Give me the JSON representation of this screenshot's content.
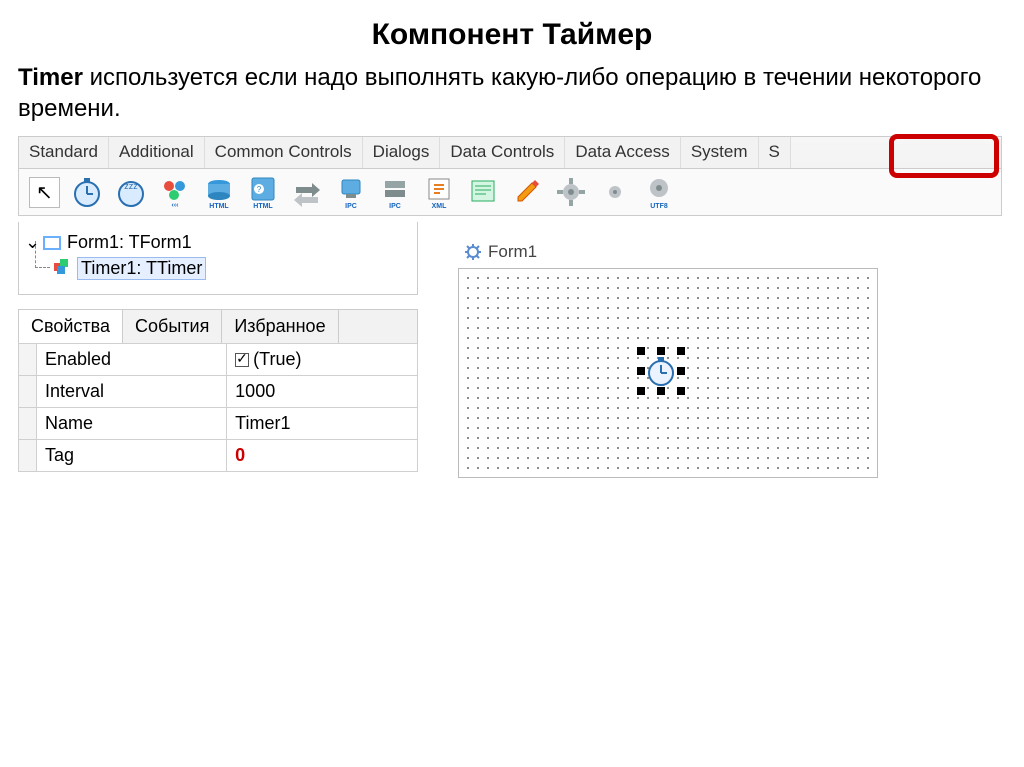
{
  "slide": {
    "title": "Компонент Таймер",
    "body_bold": "Timer",
    "body_rest": " используется если надо выполнять какую-либо операцию в течении некоторого времени."
  },
  "palette": {
    "tabs": [
      "Standard",
      "Additional",
      "Common Controls",
      "Dialogs",
      "Data Controls",
      "Data Access",
      "System",
      "S"
    ],
    "icons": [
      "timer-icon",
      "idle-timer-icon",
      "html-chunk-icon",
      "html-page-icon",
      "ipc-client-icon",
      "ipc-server-icon",
      "xml-icon",
      "daemon-icon",
      "chm-icon",
      "lazarus-icon",
      "utf8-icon",
      "gear-icon"
    ]
  },
  "tree": {
    "root_label": "Form1: TForm1",
    "child_label": "Timer1: TTimer"
  },
  "props": {
    "tabs": [
      "Свойства",
      "События",
      "Избранное"
    ],
    "rows": [
      {
        "name": "Enabled",
        "value": "(True)",
        "checkbox": true
      },
      {
        "name": "Interval",
        "value": "1000"
      },
      {
        "name": "Name",
        "value": "Timer1"
      },
      {
        "name": "Tag",
        "value": "0",
        "red": true
      }
    ]
  },
  "designer": {
    "form_label": "Form1"
  }
}
